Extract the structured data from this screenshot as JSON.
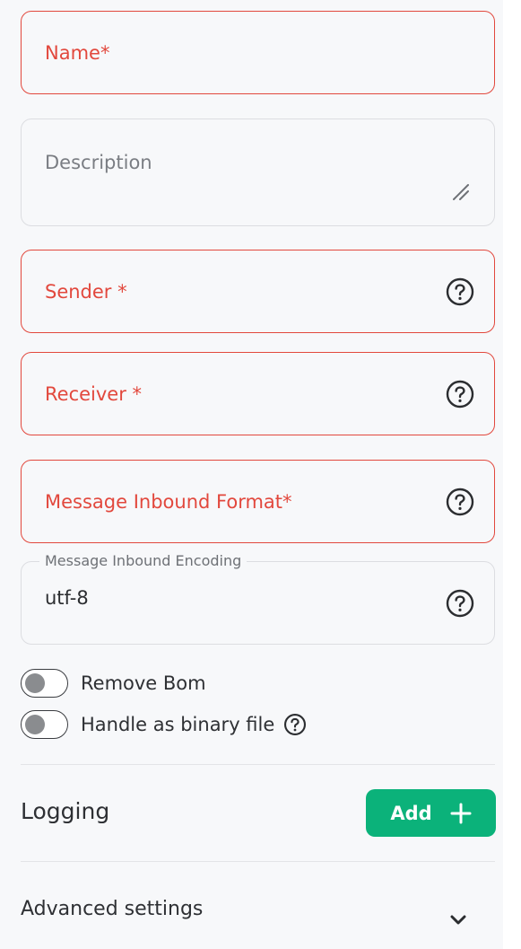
{
  "form": {
    "name_label": "Name*",
    "description_label": "Description",
    "sender_label": "Sender *",
    "receiver_label": "Receiver *",
    "inbound_format_label": "Message Inbound Format*",
    "inbound_encoding_label": "Message Inbound Encoding",
    "inbound_encoding_value": "utf-8"
  },
  "toggles": [
    {
      "label": "Remove Bom",
      "checked": false
    },
    {
      "label": "Handle as binary file",
      "checked": false
    }
  ],
  "logging": {
    "title": "Logging",
    "add_label": "Add"
  },
  "advanced": {
    "title": "Advanced settings"
  },
  "icons": {
    "help": "help-circle-icon",
    "resize": "resize-handle-icon",
    "plus": "plus-icon",
    "chevron": "chevron-down-icon"
  },
  "colors": {
    "error": "#e2483d",
    "accent": "#0bb27a"
  }
}
